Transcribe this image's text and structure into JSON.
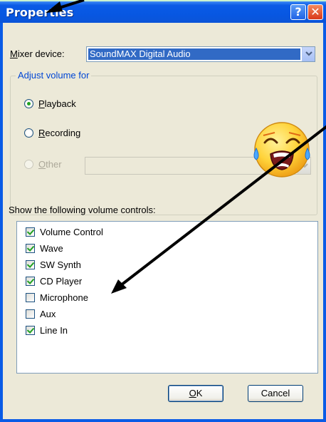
{
  "window": {
    "title": "Properties",
    "help_label": "?",
    "close_label": "✕"
  },
  "mixer": {
    "label_accel": "M",
    "label_rest": "ixer device:",
    "value": "SoundMAX Digital Audio"
  },
  "adjust_group": {
    "title": "Adjust volume for",
    "options": [
      {
        "accel": "P",
        "rest": "layback",
        "checked": true,
        "enabled": true
      },
      {
        "accel": "R",
        "rest": "ecording",
        "checked": false,
        "enabled": true
      },
      {
        "accel": "O",
        "rest": "ther",
        "checked": false,
        "enabled": false
      }
    ]
  },
  "controls": {
    "label": "Show the following volume controls:",
    "items": [
      {
        "label": "Volume Control",
        "checked": true
      },
      {
        "label": "Wave",
        "checked": true
      },
      {
        "label": "SW Synth",
        "checked": true
      },
      {
        "label": "CD Player",
        "checked": true
      },
      {
        "label": "Microphone",
        "checked": false
      },
      {
        "label": "Aux",
        "checked": false
      },
      {
        "label": "Line In",
        "checked": true
      }
    ]
  },
  "buttons": {
    "ok_accel": "O",
    "ok_rest": "K",
    "cancel": "Cancel"
  },
  "icons": {
    "face": "crying-face-icon",
    "arrow": "pointer-arrow-icon",
    "dropdown": "chevron-down-icon"
  },
  "colors": {
    "titlebar": "#0a5be6",
    "dialog_bg": "#ece9d8",
    "selection": "#316ac5",
    "group_title": "#0046d5",
    "close_red": "#d9381a",
    "check_green": "#21a121",
    "arrow": "#000000",
    "emoji_yellow": "#ffd33a"
  }
}
